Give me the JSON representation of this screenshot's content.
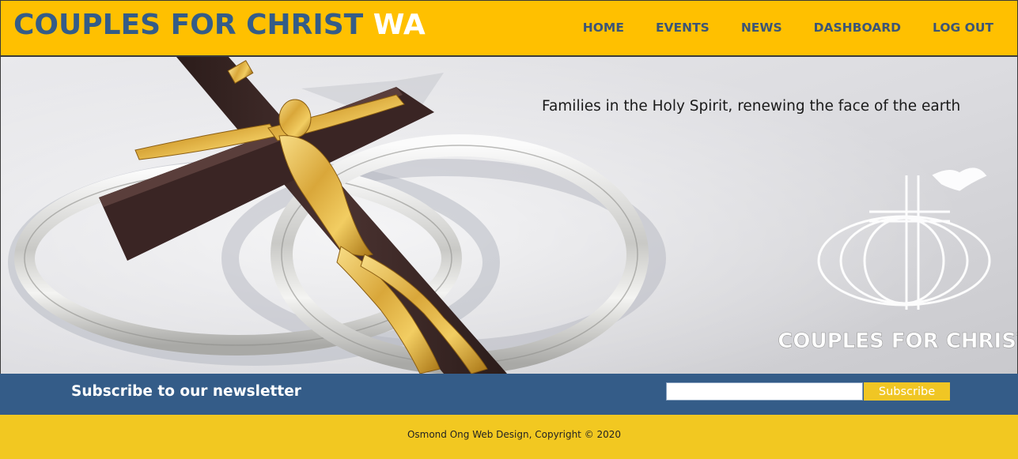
{
  "header": {
    "brand_main": "COUPLES FOR CHRIST",
    "brand_suffix": "WA",
    "nav": [
      {
        "label": "HOME"
      },
      {
        "label": "EVENTS"
      },
      {
        "label": "NEWS"
      },
      {
        "label": "DASHBOARD"
      },
      {
        "label": "LOG OUT"
      }
    ]
  },
  "hero": {
    "tagline": "Families in the Holy Spirit, renewing the face of the earth",
    "logo_text": "COUPLES FOR CHRIST",
    "image_subject": "crucifix-on-wedding-rings"
  },
  "newsletter": {
    "title": "Subscribe to our newsletter",
    "input_value": "",
    "input_placeholder": "",
    "button_label": "Subscribe"
  },
  "footer": {
    "copyright": "Osmond Ong Web Design, Copyright © 2020"
  },
  "colors": {
    "header_bg": "#ffc000",
    "brand_blue": "#345c88",
    "nav_text": "#3c5576",
    "subscribe_bar_bg": "#345c88",
    "subscribe_button_bg": "#f0c624",
    "footer_bg": "#f2c821"
  }
}
